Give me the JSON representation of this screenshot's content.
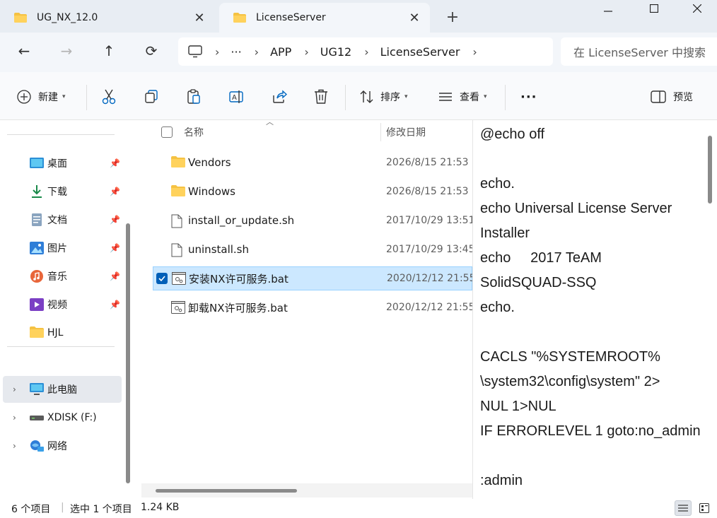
{
  "tabs": [
    {
      "label": "UG_NX_12.0",
      "active": false
    },
    {
      "label": "LicenseServer",
      "active": true
    }
  ],
  "window_controls": {
    "minimize": "—",
    "maximize": "☐",
    "close": "✕"
  },
  "nav_buttons": {
    "back": "←",
    "forward": "→",
    "up": "↑",
    "refresh": "⟳"
  },
  "breadcrumb": {
    "overflow": "···",
    "items": [
      "APP",
      "UG12",
      "LicenseServer"
    ]
  },
  "search": {
    "placeholder": "在 LicenseServer 中搜索"
  },
  "commandbar": {
    "new_label": "新建",
    "sort_label": "排序",
    "view_label": "查看",
    "more_label": "···",
    "preview_label": "预览"
  },
  "sidebar": {
    "quick_access": [
      {
        "label": "桌面",
        "icon": "desktop-icon",
        "pinned": true
      },
      {
        "label": "下载",
        "icon": "download-icon",
        "pinned": true
      },
      {
        "label": "文档",
        "icon": "document-icon",
        "pinned": true
      },
      {
        "label": "图片",
        "icon": "picture-icon",
        "pinned": true
      },
      {
        "label": "音乐",
        "icon": "music-icon",
        "pinned": true
      },
      {
        "label": "视频",
        "icon": "video-icon",
        "pinned": true
      },
      {
        "label": "HJL",
        "icon": "folder-icon",
        "pinned": false
      }
    ],
    "drives": [
      {
        "label": "此电脑",
        "icon": "this-pc-icon",
        "selected": true
      },
      {
        "label": "XDISK (F:)",
        "icon": "drive-icon",
        "selected": false
      },
      {
        "label": "网络",
        "icon": "network-icon",
        "selected": false
      }
    ]
  },
  "filelist": {
    "columns": {
      "name": "名称",
      "modified": "修改日期"
    },
    "rows": [
      {
        "name": "Vendors",
        "date": "2026/8/15 21:53",
        "type": "folder",
        "selected": false
      },
      {
        "name": "Windows",
        "date": "2026/8/15 21:53",
        "type": "folder",
        "selected": false
      },
      {
        "name": "install_or_update.sh",
        "date": "2017/10/29 13:51",
        "type": "file",
        "selected": false
      },
      {
        "name": "uninstall.sh",
        "date": "2017/10/29 13:45",
        "type": "file",
        "selected": false
      },
      {
        "name": "安装NX许可服务.bat",
        "date": "2020/12/12 21:55",
        "type": "bat",
        "selected": true
      },
      {
        "name": "卸载NX许可服务.bat",
        "date": "2020/12/12 21:55",
        "type": "bat",
        "selected": false
      }
    ]
  },
  "preview": {
    "text": "@echo off\n\necho.\necho Universal License Server\nInstaller\necho     2017 TeAM\nSolidSQUAD-SSQ\necho.\n\nCACLS \"%SYSTEMROOT%\n\\system32\\config\\system\" 2>\nNUL 1>NUL\nIF ERRORLEVEL 1 goto:no_admin\n\n:admin"
  },
  "status": {
    "item_count": "6 个项目",
    "selection": "选中 1 个项目",
    "size": "1.24 KB"
  },
  "colors": {
    "accent": "#005fb8",
    "selection_bg": "#cce8ff",
    "folder_yellow": "#f5c242"
  }
}
